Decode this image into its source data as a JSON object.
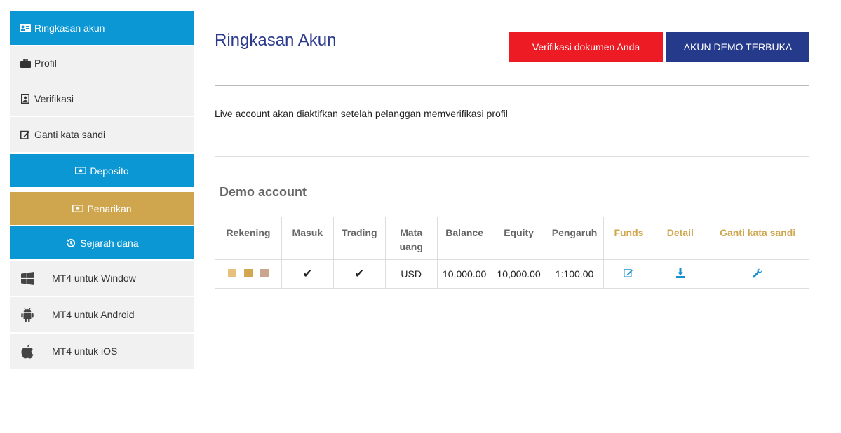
{
  "sidebar": {
    "items": [
      {
        "label": "Ringkasan akun",
        "icon": "id-card-icon"
      },
      {
        "label": "Profil",
        "icon": "briefcase-icon"
      },
      {
        "label": "Verifikasi",
        "icon": "user-badge-icon"
      },
      {
        "label": "Ganti kata sandi",
        "icon": "edit-icon"
      },
      {
        "label": "Deposito",
        "icon": "money-icon"
      },
      {
        "label": "Penarikan",
        "icon": "money-icon"
      },
      {
        "label": "Sejarah dana",
        "icon": "history-icon"
      },
      {
        "label": "MT4 untuk Window",
        "icon": "windows-icon"
      },
      {
        "label": "MT4 untuk Android",
        "icon": "android-icon"
      },
      {
        "label": "MT4 untuk iOS",
        "icon": "apple-icon"
      }
    ]
  },
  "header": {
    "title": "Ringkasan Akun",
    "verify_button": "Verifikasi dokumen Anda",
    "demo_button": "AKUN DEMO TERBUKA"
  },
  "notice": "Live account akan diaktifkan setelah pelanggan memverifikasi profil",
  "demo": {
    "title": "Demo account",
    "columns": [
      "Rekening",
      "Masuk",
      "Trading",
      "Mata uang",
      "Balance",
      "Equity",
      "Pengaruh",
      "Funds",
      "Detail",
      "Ganti kata sandi"
    ],
    "row": {
      "masuk": "✔",
      "trading": "✔",
      "currency": "USD",
      "balance": "10,000.00",
      "equity": "10,000.00",
      "leverage": "1:100.00"
    }
  },
  "colors": {
    "accent_blue": "#0b97d4",
    "gold": "#cfa54e",
    "red": "#ed1c24",
    "navy": "#263a8c"
  }
}
